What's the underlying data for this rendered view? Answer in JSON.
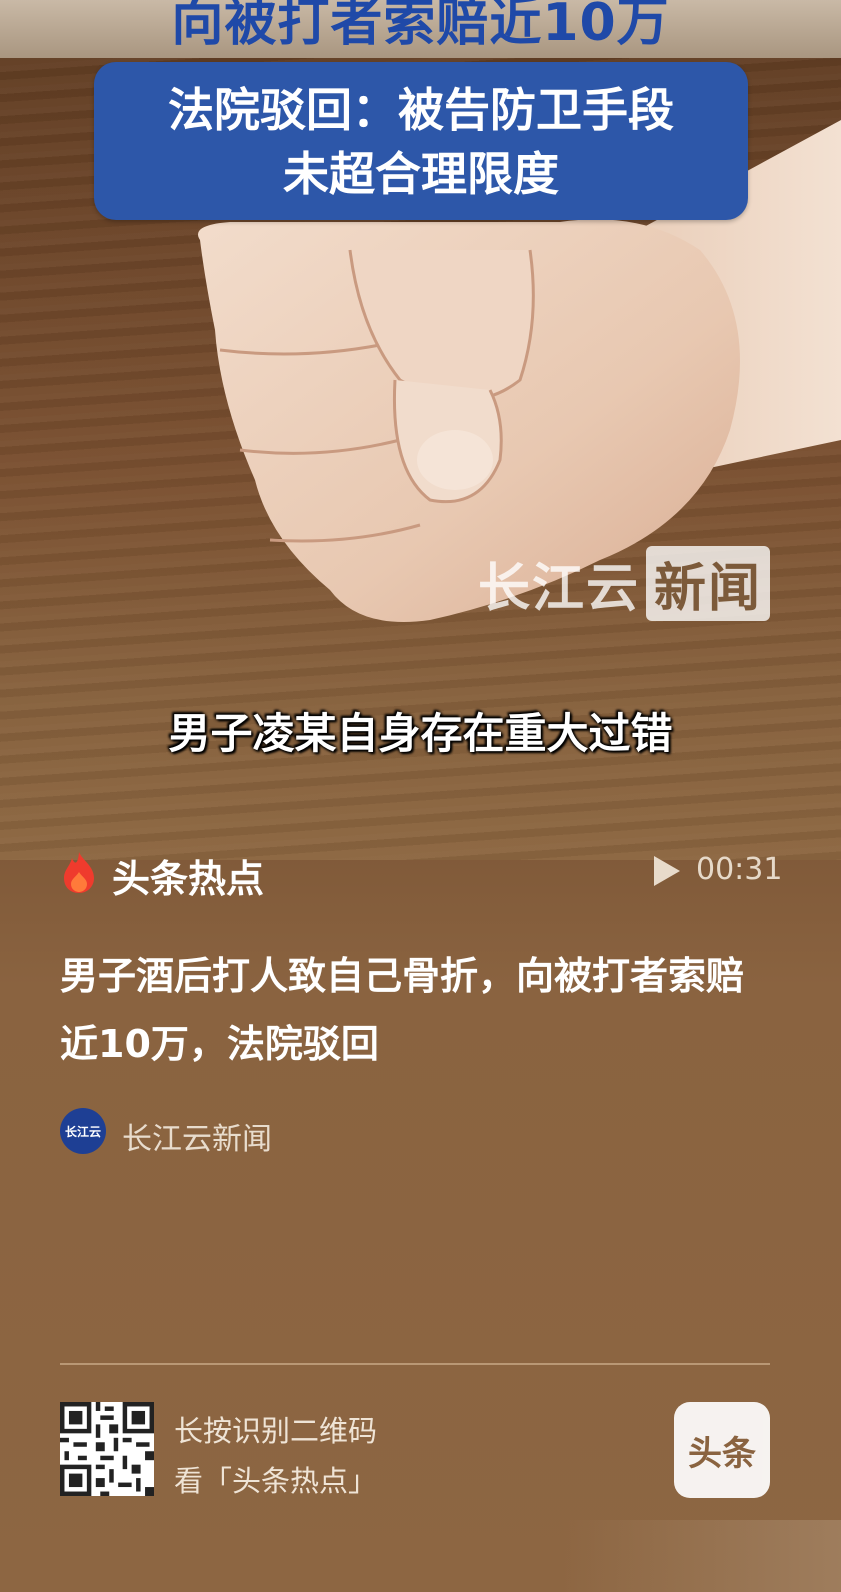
{
  "video": {
    "top_caption": "向被打者索赔近10万",
    "box_line1": "法院驳回：被告防卫手段",
    "box_line2": "未超合理限度",
    "watermark_part1": "长江云",
    "watermark_part2": "新闻",
    "subtitle": "男子凌某自身存在重大过错"
  },
  "meta": {
    "brand": "头条热点",
    "duration": "00:31"
  },
  "article": {
    "headline": "男子酒后打人致自己骨折，向被打者索赔近10万，法院驳回",
    "source_logo_text": "长江云",
    "source_name": "长江云新闻"
  },
  "footer": {
    "hint_line1": "长按识别二维码",
    "hint_line2": "看「头条热点」",
    "logo_text": "头条"
  },
  "colors": {
    "accent_blue": "#2d57a9",
    "caption_blue": "#1f49a8",
    "flame": "#ef3b2d",
    "card_brown": "#8b6440"
  }
}
